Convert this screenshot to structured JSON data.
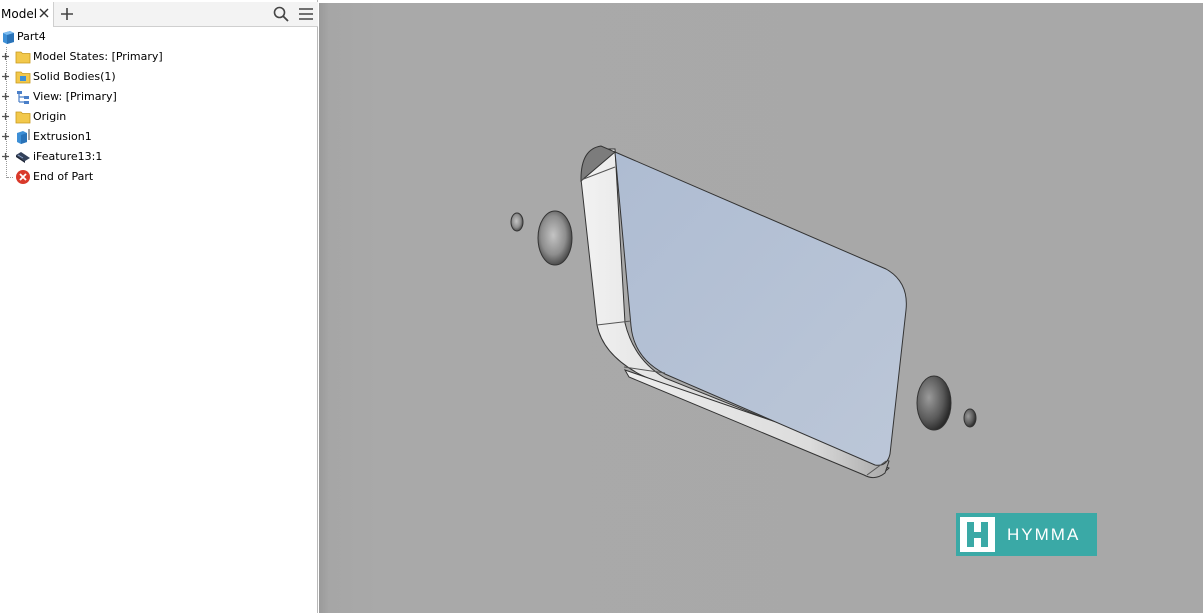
{
  "browser": {
    "tab_label": "Model",
    "tree": [
      {
        "label": "Part4",
        "icon": "part-icon",
        "expandable": false
      },
      {
        "label": "Model States: [Primary]",
        "icon": "folder-icon",
        "expandable": true
      },
      {
        "label": "Solid Bodies(1)",
        "icon": "solid-bodies-icon",
        "expandable": true
      },
      {
        "label": "View: [Primary]",
        "icon": "view-rep-icon",
        "expandable": true
      },
      {
        "label": "Origin",
        "icon": "folder-icon",
        "expandable": true
      },
      {
        "label": "Extrusion1",
        "icon": "extrusion-icon",
        "expandable": true
      },
      {
        "label": "iFeature13:1",
        "icon": "ifeature-icon",
        "expandable": true
      },
      {
        "label": "End of Part",
        "icon": "end-of-part-icon",
        "expandable": false
      }
    ]
  },
  "viewport": {
    "background_color": "#a8a8a8",
    "face_color": "#b4c2d6"
  },
  "logo": {
    "mark": "H",
    "text": "HYMMA",
    "color": "#3aa9a6"
  }
}
